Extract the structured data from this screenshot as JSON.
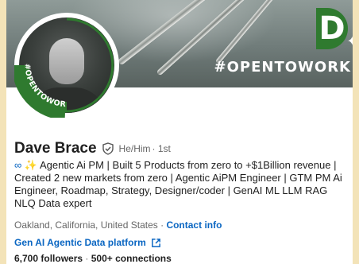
{
  "banner": {
    "tagline": "#OPENTOWORK",
    "brand_letter": "D"
  },
  "avatar": {
    "badge_text": "#OPENTOWORK"
  },
  "profile": {
    "name": "Dave Brace",
    "pronouns": "He/Him",
    "degree": "· 1st",
    "headline_prefix_icon": "infinity-icon",
    "headline_sparkle": "✨",
    "headline": "Agentic Ai PM | Built 5 Products from zero to +$1Billion revenue | Created 2 new markets from zero | Agentic AiPM Engineer | GTM PM Ai Engineer, Roadmap, Strategy, Designer/coder | GenAI ML LLM RAG NLQ Data expert",
    "location": "Oakland, California, United States ·",
    "contact_label": "Contact info",
    "platform_link": "Gen AI Agentic Data platform",
    "followers": "6,700 followers",
    "connections": "500+ connections",
    "stats_sep": "·"
  },
  "colors": {
    "link": "#0a66c2",
    "otw_green": "#2f7a2f",
    "text": "#1f1f1f",
    "muted": "#666666"
  }
}
